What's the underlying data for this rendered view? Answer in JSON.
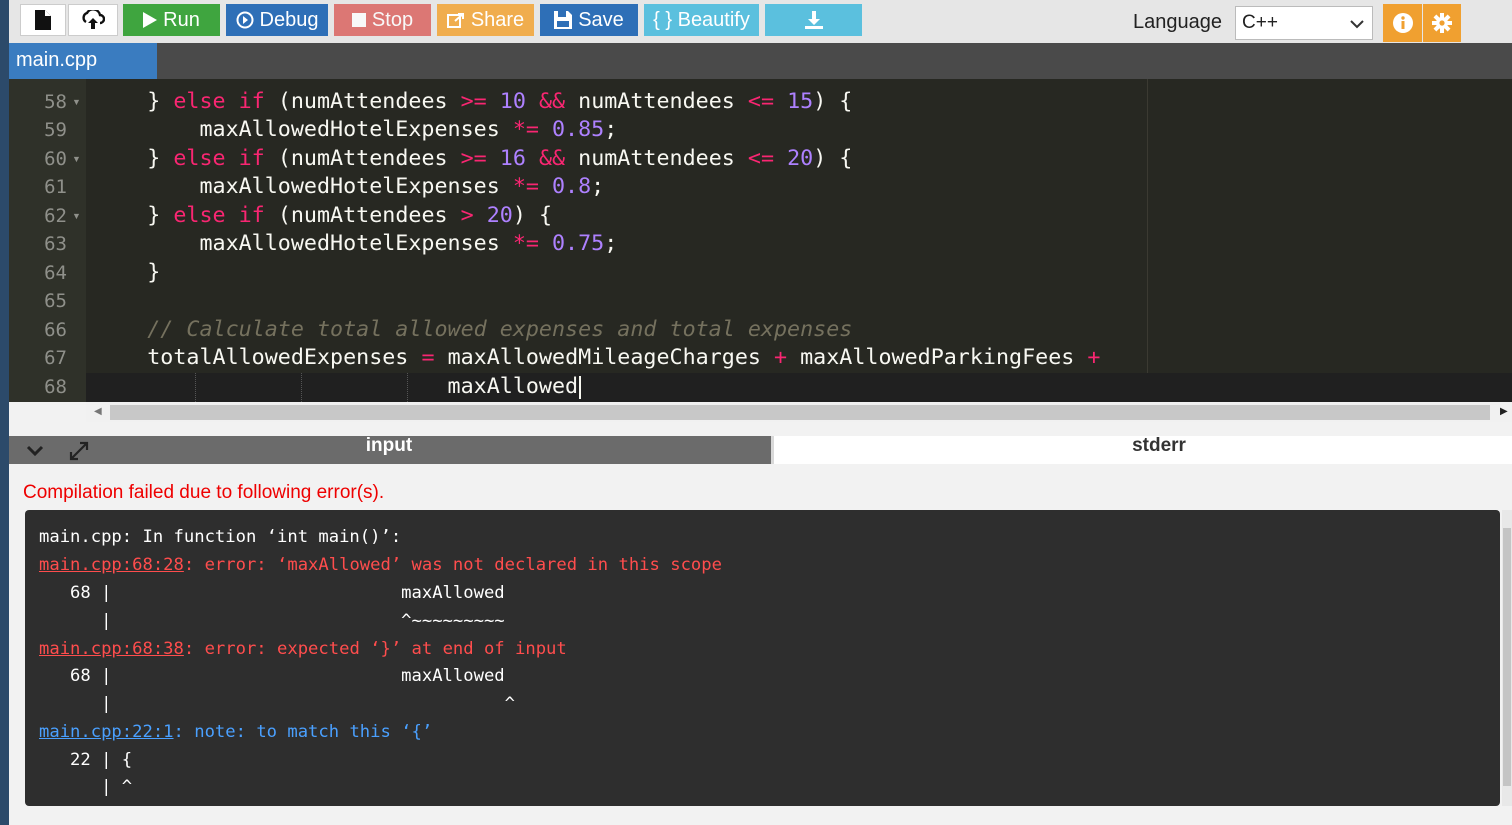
{
  "toolbar": {
    "run": "Run",
    "debug": "Debug",
    "stop": "Stop",
    "share": "Share",
    "save": "Save",
    "beautify": "{ } Beautify",
    "language_label": "Language",
    "language_value": "C++",
    "colors": {
      "run": "#3fa53f",
      "debug": "#2e6fb7",
      "stop": "#d9534f",
      "share": "#f0ad4e",
      "save": "#2e6fb7",
      "beautify": "#5bc0de",
      "download": "#5bc0de",
      "info": "#f0a030",
      "settings": "#f0a030"
    }
  },
  "tabs": {
    "file": "main.cpp"
  },
  "editor": {
    "lines": [
      {
        "n": "58",
        "fold": true
      },
      {
        "n": "59",
        "fold": false
      },
      {
        "n": "60",
        "fold": true
      },
      {
        "n": "61",
        "fold": false
      },
      {
        "n": "62",
        "fold": true
      },
      {
        "n": "63",
        "fold": false
      },
      {
        "n": "64",
        "fold": false
      },
      {
        "n": "65",
        "fold": false
      },
      {
        "n": "66",
        "fold": false
      },
      {
        "n": "67",
        "fold": false
      },
      {
        "n": "68",
        "fold": false
      }
    ],
    "code": {
      "l58": {
        "a": "    } ",
        "k1": "else if ",
        "b": "(numAttendees ",
        "o1": ">= ",
        "n1": "10 ",
        "o2": "&& ",
        "c": "numAttendees ",
        "o3": "<= ",
        "n2": "15",
        "d": ") {"
      },
      "l59": {
        "a": "        maxAllowedHotelExpenses ",
        "o": "*= ",
        "n": "0.85",
        "d": ";"
      },
      "l60": {
        "a": "    } ",
        "k1": "else if ",
        "b": "(numAttendees ",
        "o1": ">= ",
        "n1": "16 ",
        "o2": "&& ",
        "c": "numAttendees ",
        "o3": "<= ",
        "n2": "20",
        "d": ") {"
      },
      "l61": {
        "a": "        maxAllowedHotelExpenses ",
        "o": "*= ",
        "n": "0.8",
        "d": ";"
      },
      "l62": {
        "a": "    } ",
        "k1": "else if ",
        "b": "(numAttendees ",
        "o1": "> ",
        "n1": "20",
        "d": ") {"
      },
      "l63": {
        "a": "        maxAllowedHotelExpenses ",
        "o": "*= ",
        "n": "0.75",
        "d": ";"
      },
      "l64": "    }",
      "l66": "    // Calculate total allowed expenses and total expenses",
      "l67": {
        "a": "    totalAllowedExpenses ",
        "o1": "= ",
        "b": "maxAllowedMileageCharges ",
        "o2": "+ ",
        "c": "maxAllowedParkingFees ",
        "o3": "+"
      },
      "l68": "                           maxAllowed"
    }
  },
  "io": {
    "tab_input": "input",
    "tab_stderr": "stderr",
    "error_message": "Compilation failed due to following error(s)."
  },
  "console": {
    "l1": "main.cpp: In function ‘int main()’:",
    "l2_loc": "main.cpp:68:28",
    "l2_msg": ": error: ‘maxAllowed’ was not declared in this scope",
    "l3": "   68 |                            maxAllowed",
    "l4": "      |                            ^~~~~~~~~~",
    "l5_loc": "main.cpp:68:38",
    "l5_msg": ": error: expected ‘}’ at end of input",
    "l6": "   68 |                            maxAllowed",
    "l7": "      |                                      ^",
    "l8_loc": "main.cpp:22:1",
    "l8_msg": ": note: to match this ‘{’",
    "l9": "   22 | {",
    "l10": "      | ^"
  }
}
